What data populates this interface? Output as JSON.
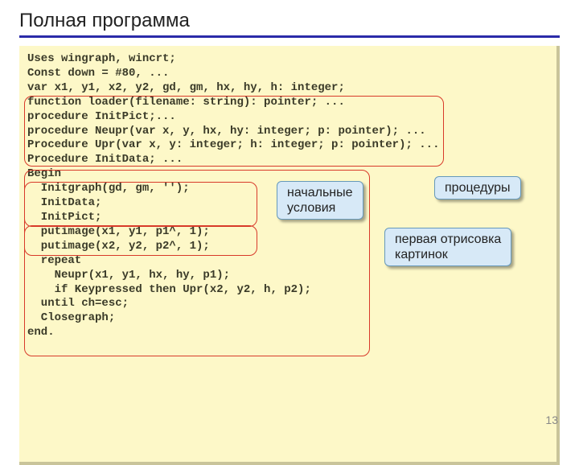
{
  "title": "Полная программа",
  "code": "Uses wingraph, wincrt;\nConst down = #80, ...\nvar x1, y1, x2, y2, gd, gm, hx, hy, h: integer;\nfunction loader(filename: string): pointer; ...\nprocedure InitPict;...\nprocedure Neupr(var x, y, hx, hy: integer; p: pointer); ...\nProcedure Upr(var x, y: integer; h: integer; p: pointer); ...\nProcedure InitData; ...\nBegin\n  Initgraph(gd, gm, '');\n  InitData;\n  InitPict;\n  putimage(x1, y1, p1^, 1);\n  putimage(x2, y2, p2^, 1);\n  repeat\n    Neupr(x1, y1, hx, hy, p1);\n    if Keypressed then Upr(x2, y2, h, p2);\n  until ch=esc;\n  Closegraph;\nend.",
  "callouts": {
    "procedures": "процедуры",
    "initial": "начальные\nусловия",
    "first_draw": "первая отрисовка\nкартинок"
  },
  "page_number": "13"
}
